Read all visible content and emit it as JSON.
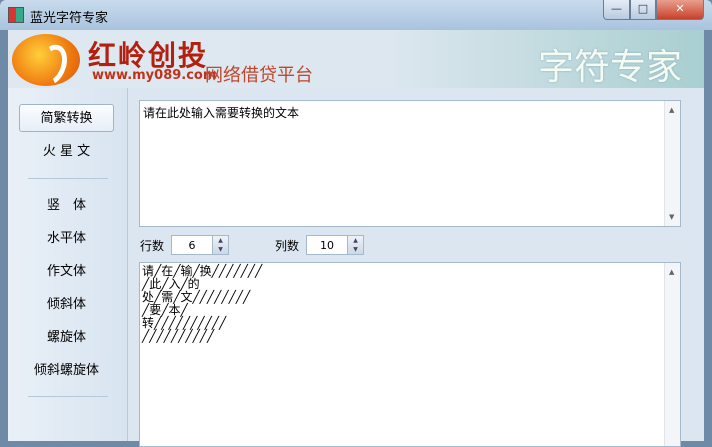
{
  "window": {
    "title": "蓝光字符专家",
    "minimize": "—",
    "maximize": "□",
    "close": "✕"
  },
  "banner": {
    "brand": "红岭创投",
    "url": "www.my089.com",
    "slogan": "网络借贷平台",
    "product": "字符专家"
  },
  "sidebar": {
    "items": [
      {
        "label": "简繁转换",
        "active": true
      },
      {
        "label": "火 星 文"
      },
      {
        "label": "竖　体"
      },
      {
        "label": "水平体"
      },
      {
        "label": "作文体"
      },
      {
        "label": "倾斜体"
      },
      {
        "label": "螺旋体"
      },
      {
        "label": "倾斜螺旋体"
      }
    ]
  },
  "input": {
    "text": "请在此处输入需要转换的文本"
  },
  "controls": {
    "rows_label": "行数",
    "rows_value": "6",
    "cols_label": "列数",
    "cols_value": "10"
  },
  "output": {
    "lines": [
      "请╱在╱输╱换╱╱╱╱╱╱╱",
      "╱此╱入╱的",
      "处╱需╱文╱╱╱╱╱╱╱╱",
      "╱要╱本╱",
      "转╱╱╱╱╱╱╱╱╱╱",
      "╱╱╱╱╱╱╱╱╱╱"
    ]
  }
}
